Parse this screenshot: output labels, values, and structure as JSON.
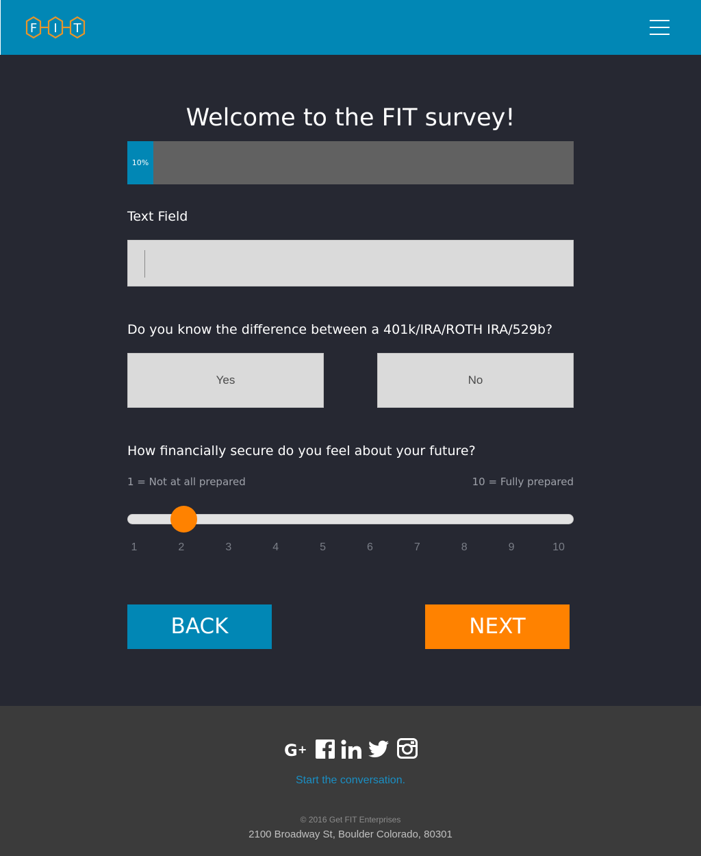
{
  "header": {
    "logo_letters": [
      "F",
      "I",
      "T"
    ],
    "logo_color": "#e8952a",
    "background_color": "#0187b5",
    "menu_icon": "hamburger-menu-icon"
  },
  "survey": {
    "title": "Welcome to the FIT survey!",
    "progress": {
      "percent": 10,
      "label": "10%"
    },
    "text_field": {
      "label": "Text Field",
      "value": "",
      "placeholder": ""
    },
    "question_yes_no": {
      "label": "Do you know the difference between a 401k/IRA/ROTH IRA/529b?",
      "options": [
        "Yes",
        "No"
      ]
    },
    "question_scale": {
      "label": "How financially secure do you feel about your future?",
      "min_hint": "1 = Not at all prepared",
      "max_hint": "10 = Fully prepared",
      "ticks": [
        "1",
        "2",
        "3",
        "4",
        "5",
        "6",
        "7",
        "8",
        "9",
        "10"
      ],
      "value": 2,
      "min": 1,
      "max": 10
    },
    "buttons": {
      "back": "BACK",
      "next": "NEXT"
    }
  },
  "colors": {
    "accent_blue": "#0187b5",
    "accent_orange": "#ff8200",
    "page_background": "#262832",
    "footer_background": "#3b3b3b"
  },
  "footer": {
    "social_icons": [
      "google-plus-icon",
      "facebook-icon",
      "linkedin-icon",
      "twitter-icon",
      "instagram-icon"
    ],
    "cta": "Start the conversation.",
    "copyright": "© 2016 Get FIT Enterprises",
    "address": "2100 Broadway St, Boulder Colorado, 80301"
  }
}
